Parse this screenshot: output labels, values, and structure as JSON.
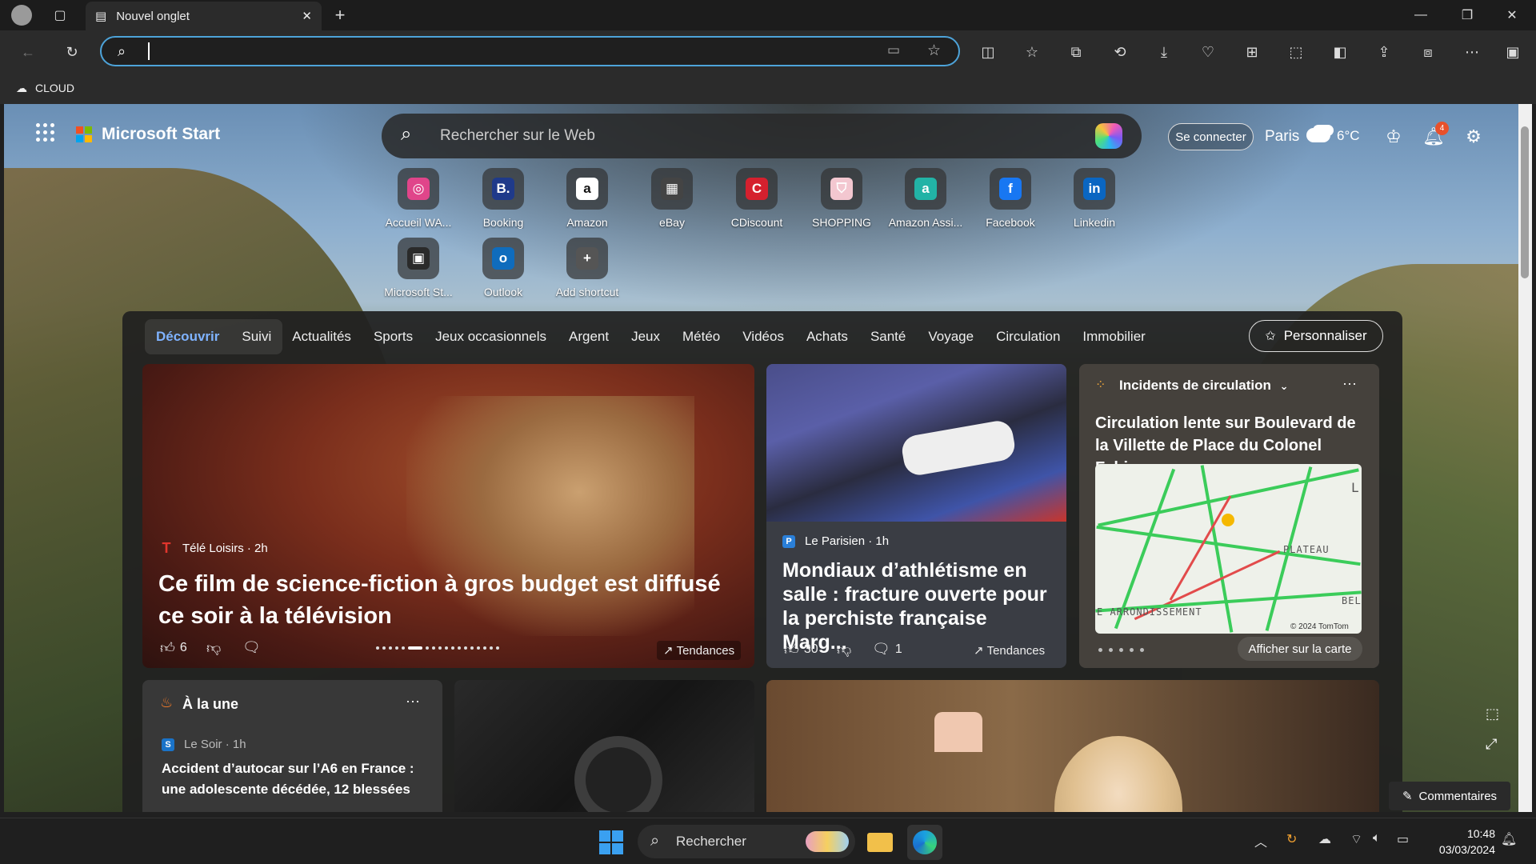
{
  "browser": {
    "tab_title": "Nouvel onglet",
    "address_value": "",
    "favorites": [
      {
        "label": "CLOUD",
        "icon": "cloud-icon"
      }
    ]
  },
  "header": {
    "brand": "Microsoft Start",
    "search_placeholder": "Rechercher sur le Web",
    "signin": "Se connecter",
    "weather_city": "Paris",
    "weather_temp": "6°C",
    "notif_count": "4"
  },
  "shortcuts": [
    {
      "label": "Accueil WA...",
      "color": "#e0458a",
      "glyph": "◎"
    },
    {
      "label": "Booking",
      "color": "#1f3a8a",
      "glyph": "B."
    },
    {
      "label": "Amazon",
      "color": "#ffffff",
      "glyph": "a"
    },
    {
      "label": "eBay",
      "color": "#444444",
      "glyph": "▦"
    },
    {
      "label": "CDiscount",
      "color": "#d5202e",
      "glyph": "C"
    },
    {
      "label": "SHOPPING",
      "color": "#f3c7d0",
      "glyph": "⛉"
    },
    {
      "label": "Amazon Assi...",
      "color": "#22b3a6",
      "glyph": "a"
    },
    {
      "label": "Facebook",
      "color": "#1877f2",
      "glyph": "f"
    },
    {
      "label": "Linkedin",
      "color": "#0a66c2",
      "glyph": "in"
    },
    {
      "label": "Microsoft St...",
      "color": "#2a2a2a",
      "glyph": "▣"
    },
    {
      "label": "Outlook",
      "color": "#0f6cbd",
      "glyph": "o"
    },
    {
      "label": "Add shortcut",
      "color": "#555555",
      "glyph": "+"
    }
  ],
  "feed_nav": {
    "active": "Découvrir",
    "items": [
      "Suivi",
      "Actualités",
      "Sports",
      "Jeux occasionnels",
      "Argent",
      "Jeux",
      "Météo",
      "Vidéos",
      "Achats",
      "Santé",
      "Voyage",
      "Circulation",
      "Immobilier"
    ],
    "customize": "Personnaliser"
  },
  "hero": {
    "source": "Télé Loisirs · 2h",
    "headline": "Ce film de science-fiction à gros budget est diffusé ce soir à la télévision",
    "likes": "6",
    "trend": "Tendances"
  },
  "athletics": {
    "source": "Le Parisien · 1h",
    "headline": "Mondiaux d’athlétisme en salle : fracture ouverte pour la perchiste française Marg...",
    "likes": "30",
    "comments": "1",
    "trend": "Tendances"
  },
  "traffic": {
    "title": "Incidents de circulation",
    "headline": "Circulation lente sur Boulevard de la Villette de Place du Colonel Fabien...",
    "map_labels": [
      "PLATEAU",
      "E ARRONDISSEMENT",
      "BEL",
      "L"
    ],
    "map_copyright": "© 2024 TomTom",
    "map_button": "Afficher sur la carte"
  },
  "top_news": {
    "title": "À la une",
    "source": "Le Soir · 1h",
    "headline": "Accident d’autocar sur l’A6 en France : une adolescente décédée, 12 blessées"
  },
  "feedback": "Commentaires",
  "taskbar": {
    "search": "Rechercher",
    "time": "10:48",
    "date": "03/03/2024"
  }
}
